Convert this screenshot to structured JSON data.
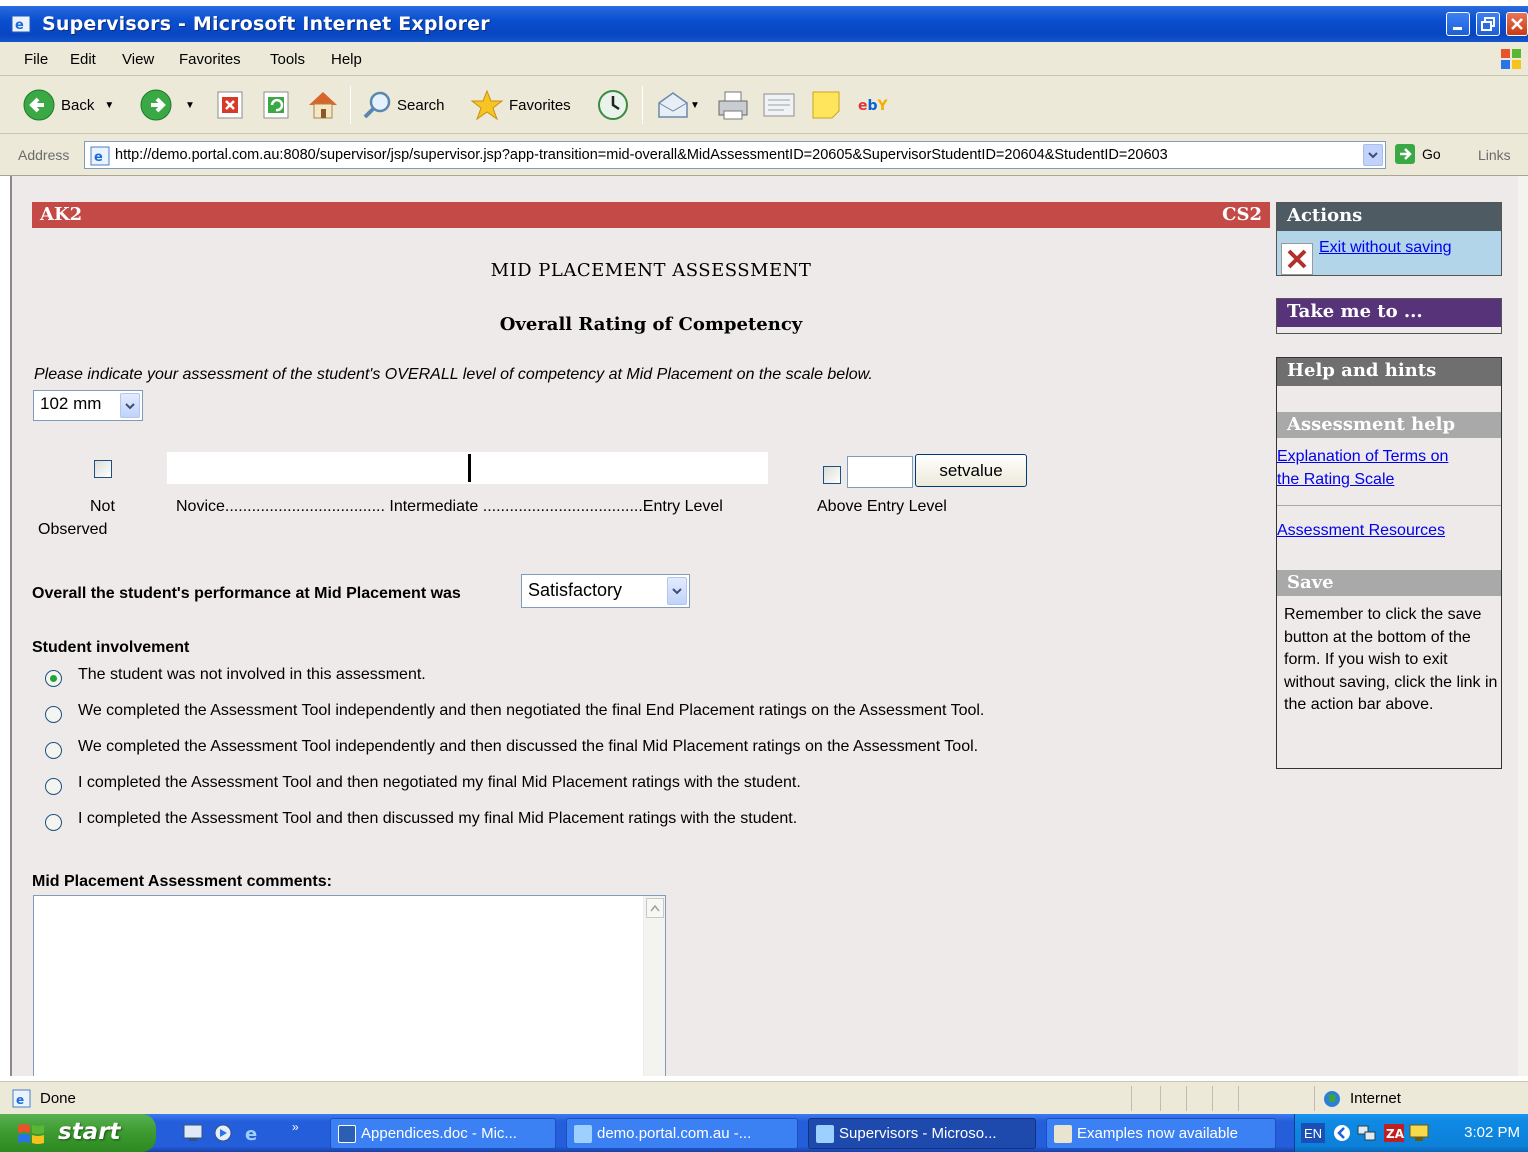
{
  "window": {
    "title": "Supervisors - Microsoft Internet Explorer"
  },
  "menu": [
    "File",
    "Edit",
    "View",
    "Favorites",
    "Tools",
    "Help"
  ],
  "toolbar": {
    "back": "Back",
    "search": "Search",
    "favorites": "Favorites"
  },
  "address": {
    "label": "Address",
    "url": "http://demo.portal.com.au:8080/supervisor/jsp/supervisor.jsp?app-transition=mid-overall&MidAssessmentID=20605&SupervisorStudentID=20604&StudentID=20603",
    "go": "Go",
    "links": "Links"
  },
  "page": {
    "bar_left": "AK2",
    "bar_right": "CS2",
    "heading": "MID PLACEMENT ASSESSMENT",
    "subheading": "Overall Rating of Competency",
    "instruction": "Please indicate your assessment of the student's OVERALL level of competency at Mid Placement on the scale below.",
    "size_select": "102 mm",
    "scale": {
      "not_observed_1": "Not",
      "not_observed_2": "Observed",
      "labels": "Novice.................................... Intermediate ....................................Entry Level",
      "above": "Above Entry Level",
      "setvalue": "setvalue",
      "marker_fraction": 0.5
    },
    "performance_label": "Overall the student's performance at Mid Placement was",
    "performance_value": "Satisfactory",
    "involvement_heading": "Student involvement",
    "involvement_options": [
      {
        "label": "The student was not involved in this assessment.",
        "selected": true
      },
      {
        "label": "We completed the Assessment Tool independently and then negotiated the final End Placement ratings on the Assessment Tool.",
        "selected": false
      },
      {
        "label": "We completed the Assessment Tool independently and then discussed the final Mid Placement ratings on the Assessment Tool.",
        "selected": false
      },
      {
        "label": "I completed the Assessment Tool and then negotiated my final Mid Placement ratings with the student.",
        "selected": false
      },
      {
        "label": "I completed the Assessment Tool and then discussed my final Mid Placement ratings with the student.",
        "selected": false
      }
    ],
    "comments_label": "Mid Placement Assessment comments:"
  },
  "sidebar": {
    "actions_title": "Actions",
    "exit_link": "Exit without saving",
    "takeme_title": "Take me to ...",
    "help_title": "Help and hints",
    "assessment_help_title": "Assessment help",
    "link_terms_1": "Explanation of Terms on",
    "link_terms_2": "the Rating Scale",
    "link_resources": "Assessment Resources",
    "save_title": "Save",
    "save_note": "Remember to click the save button at the bottom of the form. If you wish to exit without saving, click the link in the action bar above."
  },
  "status": {
    "text": "Done",
    "zone": "Internet"
  },
  "taskbar": {
    "start": "start",
    "tasks": [
      "Appendices.doc - Mic...",
      "demo.portal.com.au -...",
      "Supervisors - Microso...",
      "Examples now available"
    ],
    "lang": "EN",
    "clock": "3:02 PM"
  },
  "colors": {
    "header_bar": "#c34a46",
    "actions_bg": "#b2d5ea",
    "takeme_head": "#57347a",
    "help_head": "#6f6f6f"
  }
}
